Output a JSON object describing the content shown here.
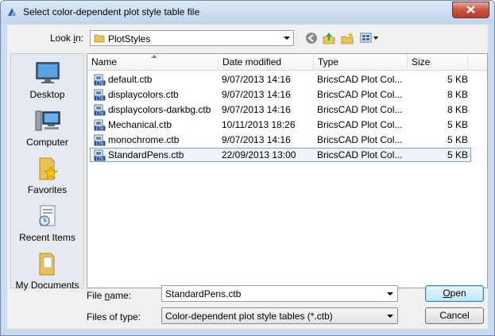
{
  "window": {
    "title": "Select color-dependent plot style table file"
  },
  "lookin": {
    "label_pre": "Look ",
    "label_u": "i",
    "label_post": "n:",
    "value": "PlotStyles"
  },
  "places": [
    {
      "label": "Desktop",
      "icon": "desktop-icon"
    },
    {
      "label": "Computer",
      "icon": "computer-icon"
    },
    {
      "label": "Favorites",
      "icon": "favorites-icon"
    },
    {
      "label": "Recent Items",
      "icon": "recent-items-icon"
    },
    {
      "label": "My Documents",
      "icon": "my-documents-icon"
    }
  ],
  "columns": [
    "Name",
    "Date modified",
    "Type",
    "Size"
  ],
  "files": [
    {
      "name": "default.ctb",
      "date": "9/07/2013 14:16",
      "type": "BricsCAD Plot Col...",
      "size": "5 KB"
    },
    {
      "name": "displaycolors.ctb",
      "date": "9/07/2013 14:16",
      "type": "BricsCAD Plot Col...",
      "size": "8 KB"
    },
    {
      "name": "displaycolors-darkbg.ctb",
      "date": "9/07/2013 14:16",
      "type": "BricsCAD Plot Col...",
      "size": "8 KB"
    },
    {
      "name": "Mechanical.ctb",
      "date": "10/11/2013 18:26",
      "type": "BricsCAD Plot Col...",
      "size": "5 KB"
    },
    {
      "name": "monochrome.ctb",
      "date": "9/07/2013 14:16",
      "type": "BricsCAD Plot Col...",
      "size": "5 KB"
    },
    {
      "name": "StandardPens.ctb",
      "date": "22/09/2013 13:00",
      "type": "BricsCAD Plot Col...",
      "size": "5 KB"
    }
  ],
  "file_icon_text": "CTB",
  "filename": {
    "label_pre": "File ",
    "label_u": "n",
    "label_post": "ame:",
    "value": "StandardPens.ctb"
  },
  "filetype": {
    "label": "Files of type:",
    "value": "Color-dependent plot style tables (*.ctb)"
  },
  "buttons": {
    "open_u": "O",
    "open_rest": "pen",
    "cancel": "Cancel"
  },
  "colors": {
    "selection_border": "#7da2ce",
    "default_button": "#3c7fb1"
  }
}
